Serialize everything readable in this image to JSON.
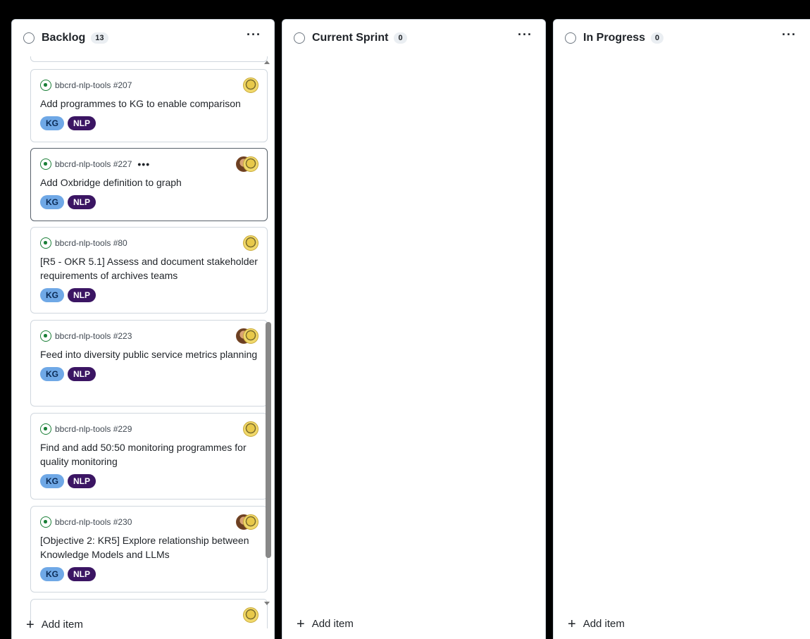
{
  "columns": [
    {
      "title": "Backlog",
      "count": "13",
      "add_label": "Add item"
    },
    {
      "title": "Current Sprint",
      "count": "0",
      "add_label": "Add item"
    },
    {
      "title": "In Progress",
      "count": "0",
      "add_label": "Add item"
    }
  ],
  "menu_glyph": "···",
  "card_menu_glyph": "•••",
  "plus_glyph": "+",
  "cards": [
    {
      "repo": "bbcrd-nlp-tools #207",
      "title": "Add programmes to KG to enable comparison",
      "labels": [
        "KG",
        "NLP"
      ]
    },
    {
      "repo": "bbcrd-nlp-tools #227",
      "title": "Add Oxbridge definition to graph",
      "labels": [
        "KG",
        "NLP"
      ]
    },
    {
      "repo": "bbcrd-nlp-tools #80",
      "title": "[R5 - OKR 5.1] Assess and document stakeholder requirements of archives teams",
      "labels": [
        "KG",
        "NLP"
      ]
    },
    {
      "repo": "bbcrd-nlp-tools #223",
      "title": "Feed into diversity public service metrics planning",
      "labels": [
        "KG",
        "NLP"
      ]
    },
    {
      "repo": "bbcrd-nlp-tools #229",
      "title": "Find and add 50:50 monitoring programmes for quality monitoring",
      "labels": [
        "KG",
        "NLP"
      ]
    },
    {
      "repo": "bbcrd-nlp-tools #230",
      "title": "[Objective 2: KR5] Explore relationship between Knowledge Models and LLMs",
      "labels": [
        "KG",
        "NLP"
      ]
    }
  ],
  "colors": {
    "label_kg": "#6fa8e6",
    "label_nlp": "#3b1563",
    "issue_open": "#1a7f37"
  }
}
